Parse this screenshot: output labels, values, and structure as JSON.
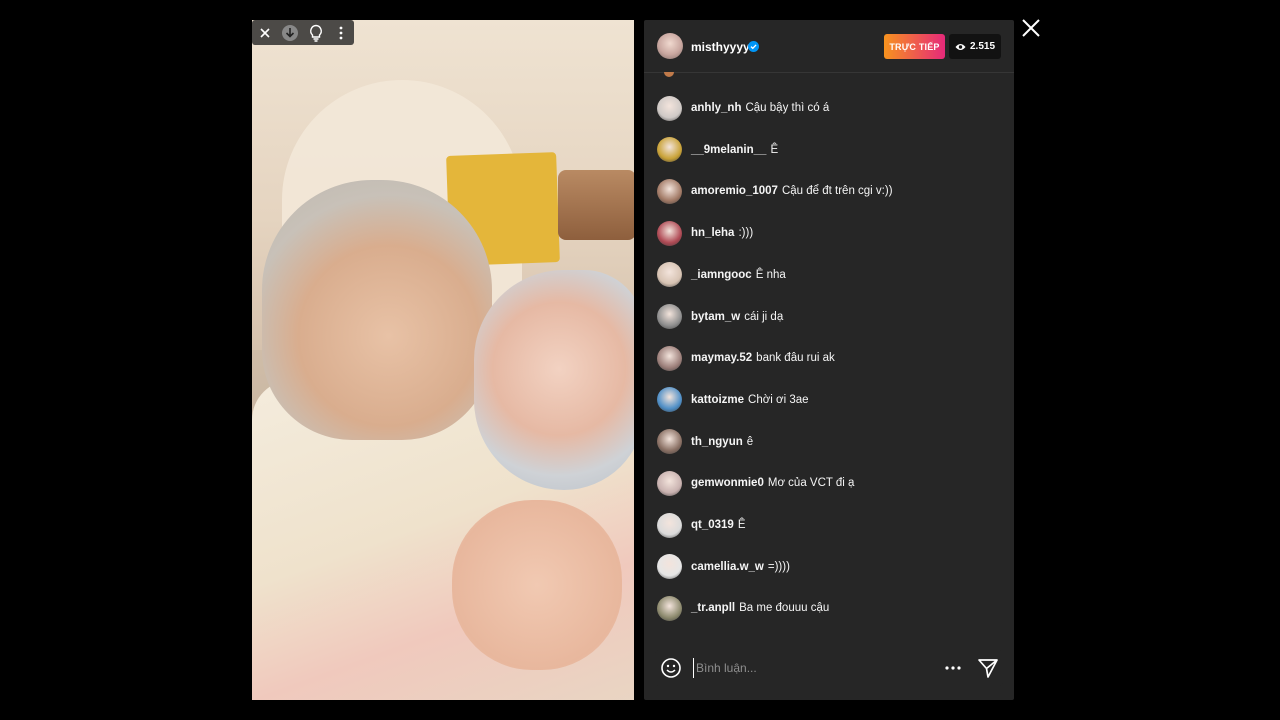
{
  "video": {
    "toolbar": {
      "icons": [
        "close-icon",
        "download-icon",
        "lightbulb-icon",
        "more-vertical-icon"
      ]
    }
  },
  "header": {
    "username": "misthyyyy",
    "verified": true,
    "live_label": "TRỰC TIẾP",
    "viewer_count": "2.515"
  },
  "comments": [
    {
      "user": "anhly_nh",
      "text": "Cậu bậy thì có á",
      "avatar_color": "#cfc9c6"
    },
    {
      "user": "__9melanin__",
      "text": "Ê",
      "avatar_color": "#c9a237"
    },
    {
      "user": "amoremio_1007",
      "text": "Cậu để đt trên cgi v:))",
      "avatar_color": "#a27a66"
    },
    {
      "user": "hn_leha",
      "text": ":)))",
      "avatar_color": "#b04a55"
    },
    {
      "user": "_iamngooc",
      "text": "Ê nha",
      "avatar_color": "#d7c3b3"
    },
    {
      "user": "bytam_w",
      "text": "cái ji dạ",
      "avatar_color": "#8f8f8f"
    },
    {
      "user": "maymay.52",
      "text": "bank đâu rui ak",
      "avatar_color": "#9c7f7a"
    },
    {
      "user": "kattoizme",
      "text": "Chời ơi 3ae",
      "avatar_color": "#4f8fc7"
    },
    {
      "user": "th_ngyun",
      "text": "ê",
      "avatar_color": "#8a7064"
    },
    {
      "user": "gemwonmie0",
      "text": "Mơ của VCT đi ạ",
      "avatar_color": "#c9b2b0"
    },
    {
      "user": "qt_0319",
      "text": "Ê",
      "avatar_color": "#dbdbdb"
    },
    {
      "user": "camellia.w_w",
      "text": "=))))",
      "avatar_color": "#e6e6e6"
    },
    {
      "user": "_tr.anpll",
      "text": "Ba me đouuu cậu",
      "avatar_color": "#8d8a6e"
    }
  ],
  "composer": {
    "placeholder": "Bình luận..."
  },
  "colors": {
    "panel_bg": "#262626",
    "live_gradient_start": "#f7931e",
    "live_gradient_end": "#e6297a",
    "verified_blue": "#0095f6"
  }
}
